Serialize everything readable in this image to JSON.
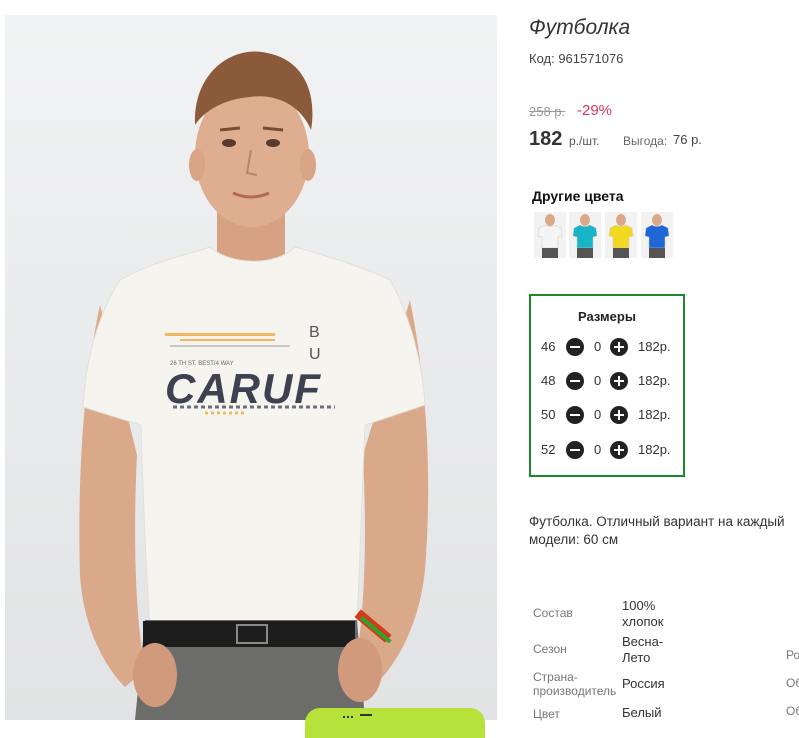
{
  "product": {
    "title": "Футболка",
    "code": "Код: 961571076"
  },
  "price": {
    "old": "258 р.",
    "discount": "-29%",
    "current": "182",
    "unit": "р./шт.",
    "saving_label": "Выгода:",
    "saving_value": "76 р."
  },
  "other_colors": {
    "title": "Другие цвета",
    "swatches": [
      {
        "name": "white",
        "shirt_color": "#f4f4f4"
      },
      {
        "name": "turquoise",
        "shirt_color": "#18b4c7"
      },
      {
        "name": "yellow",
        "shirt_color": "#f2d91f"
      },
      {
        "name": "blue",
        "shirt_color": "#2166d6"
      }
    ]
  },
  "sizes": {
    "title": "Размеры",
    "rows": [
      {
        "size": "46",
        "qty": "0",
        "price": "182р."
      },
      {
        "size": "48",
        "qty": "0",
        "price": "182р."
      },
      {
        "size": "50",
        "qty": "0",
        "price": "182р."
      },
      {
        "size": "52",
        "qty": "0",
        "price": "182р."
      }
    ]
  },
  "description": "Футболка. Отличный вариант на каждый модели: 60 см",
  "description_lines": [
    "Футболка. Отличный вариант на каждый",
    "модели: 60 см"
  ],
  "specs": [
    {
      "label": "Состав",
      "value_lines": [
        "100%",
        "хлопок"
      ]
    },
    {
      "label": "Сезон",
      "value_lines": [
        "Весна-",
        "Лето"
      ]
    },
    {
      "label_lines": [
        "Страна-",
        "производитель"
      ],
      "value_lines": [
        "Россия"
      ]
    },
    {
      "label": "Цвет",
      "value_lines": [
        "Белый"
      ]
    }
  ],
  "cut_off_right": [
    "Ро",
    "Об",
    "Об"
  ],
  "tshirt_print": {
    "brand_text": "CARUF",
    "side_letters": [
      "B",
      "U"
    ],
    "small_text": "26 TH ST. BEST/4 WAY"
  },
  "accent_colors": {
    "discount": "#e0355e",
    "sizes_border": "#1d8a2a",
    "cart_button": "#b6e23a"
  }
}
